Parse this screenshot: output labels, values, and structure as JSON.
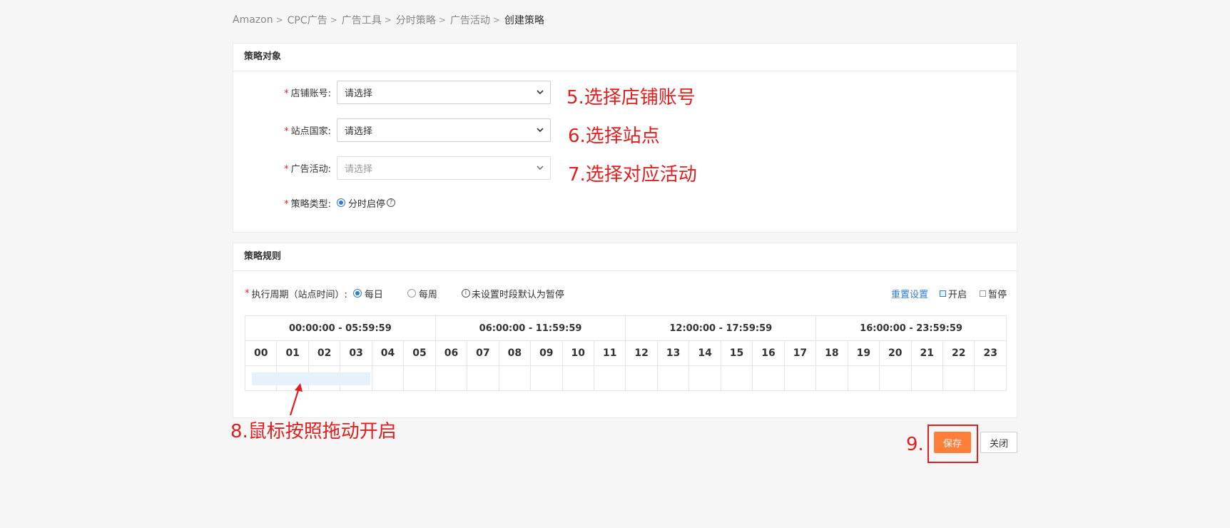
{
  "breadcrumb": [
    "Amazon",
    "CPC广告",
    "广告工具",
    "分时策略",
    "广告活动",
    "创建策略"
  ],
  "strategy_target": {
    "title": "策略对象",
    "fields": [
      {
        "label": "店铺账号:",
        "value": "请选择",
        "annotation": "5.选择店铺账号"
      },
      {
        "label": "站点国家:",
        "value": "请选择",
        "annotation": "6.选择站点"
      },
      {
        "label": "广告活动:",
        "value": "请选择",
        "annotation": "7.选择对应活动"
      }
    ],
    "strategy_type": {
      "label": "策略类型:",
      "option": "分时启停",
      "help_icon": "question-circle-icon"
    }
  },
  "strategy_rules": {
    "title": "策略规则",
    "period_label": "执行周期（站点时间）:",
    "options": [
      {
        "label": "每日",
        "checked": true
      },
      {
        "label": "每周",
        "checked": false
      }
    ],
    "note": "未设置时段默认为暂停",
    "reset_label": "重置设置",
    "legend_on": "开启",
    "legend_off": "暂停",
    "ranges": [
      "00:00:00 - 05:59:59",
      "06:00:00 - 11:59:59",
      "12:00:00 - 17:59:59",
      "16:00:00 - 23:59:59"
    ],
    "hours": [
      "00",
      "01",
      "02",
      "03",
      "04",
      "05",
      "06",
      "07",
      "08",
      "09",
      "10",
      "11",
      "12",
      "13",
      "14",
      "15",
      "16",
      "17",
      "18",
      "19",
      "20",
      "21",
      "22",
      "23"
    ],
    "annotation": "8.鼠标按照拖动开启"
  },
  "actions": {
    "annotation": "9.",
    "save_label": "保存",
    "close_label": "关闭"
  },
  "colors": {
    "accent": "#2f7bd9",
    "primary_button": "#ff7f3a",
    "annotation": "#e02020",
    "selection": "#e6f1fc"
  }
}
